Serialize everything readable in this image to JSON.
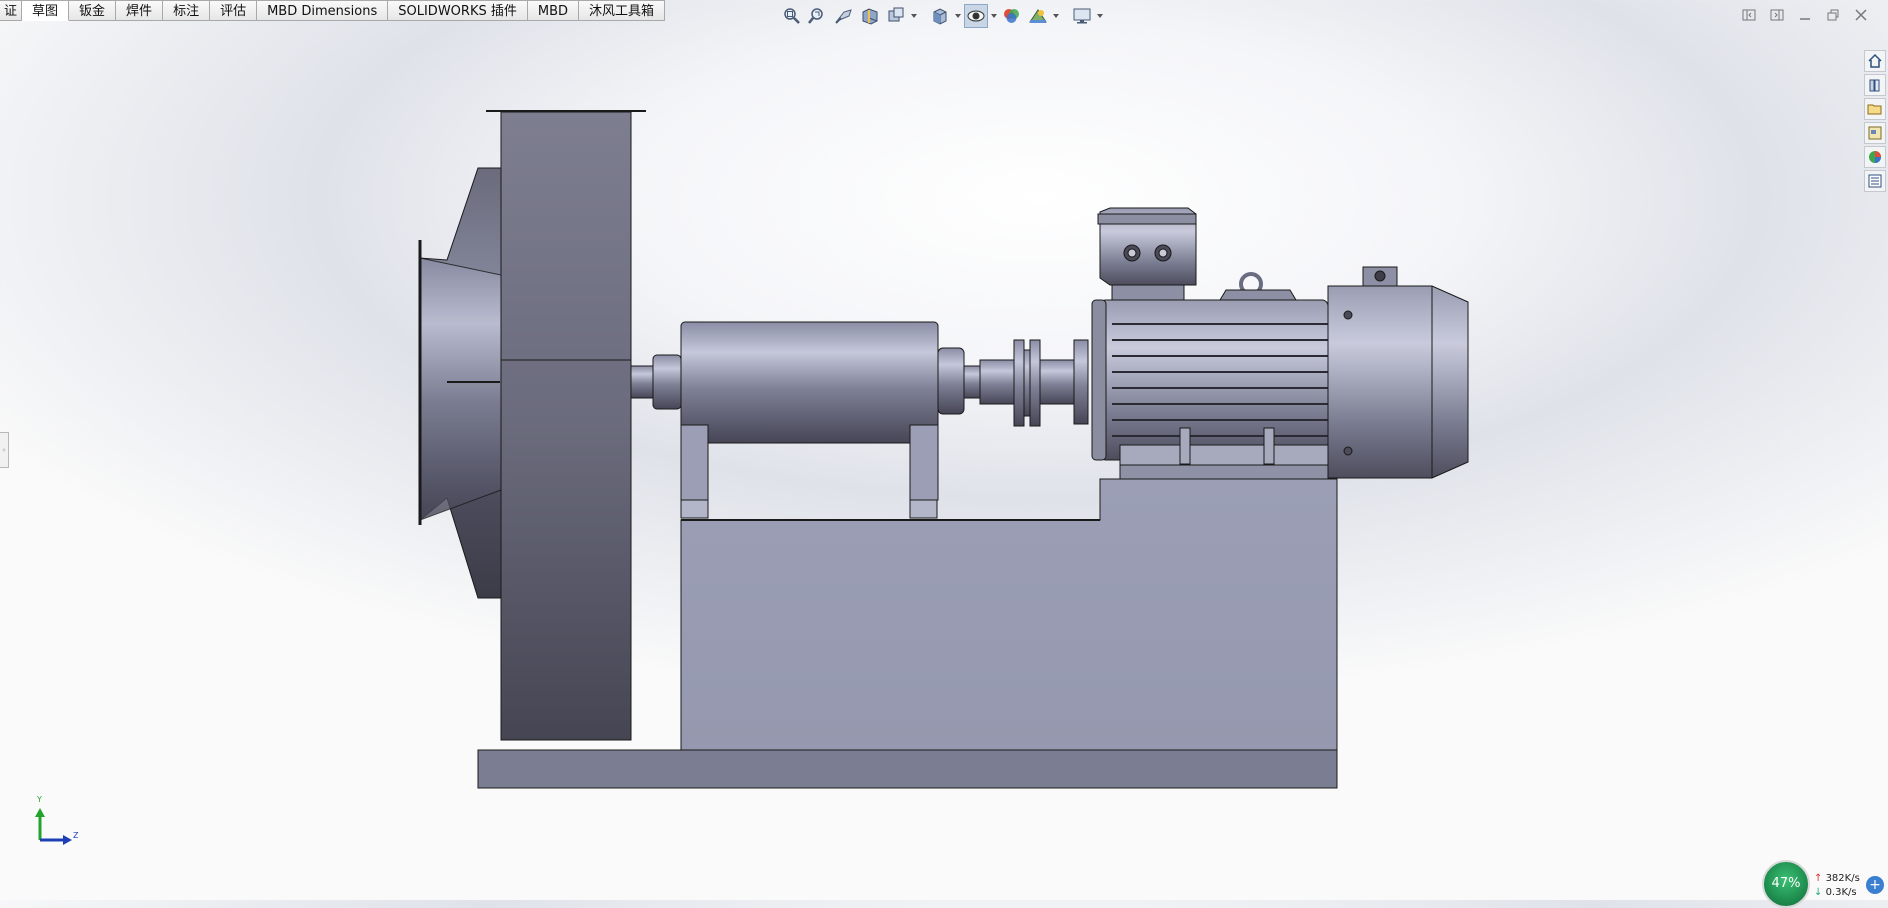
{
  "command_tabs": [
    {
      "label": "证",
      "active": false
    },
    {
      "label": "草图",
      "active": true
    },
    {
      "label": "钣金",
      "active": false
    },
    {
      "label": "焊件",
      "active": false
    },
    {
      "label": "标注",
      "active": false
    },
    {
      "label": "评估",
      "active": false
    },
    {
      "label": "MBD Dimensions",
      "active": false
    },
    {
      "label": "SOLIDWORKS 插件",
      "active": false
    },
    {
      "label": "MBD",
      "active": false
    },
    {
      "label": "沐风工具箱",
      "active": false
    }
  ],
  "heads_up_toolbar": [
    "zoom-to-fit-icon",
    "zoom-to-area-icon",
    "previous-view-icon",
    "section-view-icon",
    "dynamic-annotation-view-icon",
    "view-orientation-icon",
    "display-style-icon",
    "hide-show-items-icon",
    "edit-appearance-icon",
    "apply-scene-icon",
    "view-settings-icon"
  ],
  "task_pane": [
    "solidworks-resources-icon",
    "design-library-icon",
    "file-explorer-icon",
    "view-palette-icon",
    "appearances-scenes-icon",
    "custom-properties-icon"
  ],
  "triad": {
    "y_label": "Y",
    "z_label": "Z"
  },
  "net_monitor": {
    "percent": "47%",
    "upload": "382K/s",
    "download": "0.3K/s"
  },
  "colors": {
    "model_face": "#9a9db2",
    "model_dark": "#4b4b5a",
    "edge": "#1a1a1a",
    "triad_y": "#22a32b",
    "triad_z": "#1c3fb8"
  }
}
